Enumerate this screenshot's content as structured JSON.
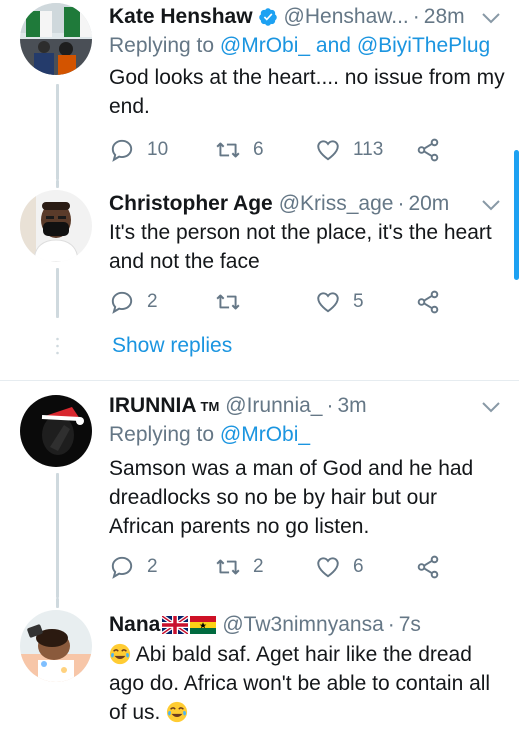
{
  "tweets": [
    {
      "name": "Kate Henshaw",
      "handle": "@Henshaw...",
      "time": "28m",
      "replying_prefix": "Replying to",
      "replying_mention_1": "@MrObi_",
      "replying_and": "and",
      "replying_mention_2": "@BiyiThePlug",
      "text": "God looks at the heart.... no issue from my end.",
      "replies": "10",
      "retweets": "6",
      "likes": "113"
    },
    {
      "name": "Christopher Age",
      "handle": "@Kriss_age",
      "time": "20m",
      "text": "It's the person not the place, it's the heart and not the face",
      "replies": "2",
      "retweets": "",
      "likes": "5",
      "show_replies": "Show replies"
    },
    {
      "name": "IRUNNIA",
      "name_suffix": "TM",
      "handle": "@Irunnia_",
      "time": "3m",
      "replying_prefix": "Replying to",
      "replying_mention_1": "@MrObi_",
      "text": "Samson was a man of God and he had dreadlocks so no be by hair but our African parents no go listen.",
      "replies": "2",
      "retweets": "2",
      "likes": "6"
    },
    {
      "name": "Nana",
      "handle": "@Tw3nimnyansa",
      "time": "7s",
      "text": "Abi bald saf. Aget hair like the dread ago do. Africa won't be able to contain all of us."
    }
  ],
  "separator": "·",
  "colors": {
    "accent": "#1b95e0",
    "muted": "#657786",
    "text": "#14171a",
    "like_icon": "#657786"
  },
  "icons": [
    "verified-badge-icon",
    "chevron-down-icon",
    "reply-icon",
    "retweet-icon",
    "like-icon",
    "share-icon",
    "joy-emoji-icon",
    "uk-flag-icon",
    "ghana-flag-icon"
  ]
}
